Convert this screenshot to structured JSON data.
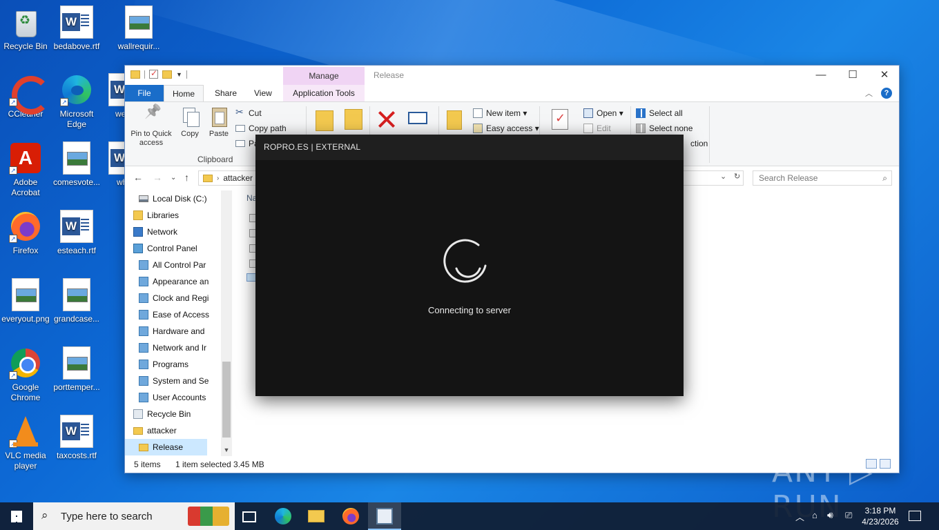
{
  "desktop": {
    "icons": [
      {
        "label": "Recycle Bin",
        "icon": "recycle-bin-icon"
      },
      {
        "label": "bedabove.rtf",
        "icon": "word-document-icon"
      },
      {
        "label": "wallrequir...",
        "icon": "image-file-icon"
      },
      {
        "label": "CCleaner",
        "icon": "ccleaner-icon"
      },
      {
        "label": "Microsoft Edge",
        "icon": "edge-icon"
      },
      {
        "label": "week",
        "icon": "word-document-icon"
      },
      {
        "label": "Adobe Acrobat",
        "icon": "acrobat-icon"
      },
      {
        "label": "comesvote...",
        "icon": "image-file-icon"
      },
      {
        "label": "whyi",
        "icon": "word-document-icon"
      },
      {
        "label": "Firefox",
        "icon": "firefox-icon"
      },
      {
        "label": "esteach.rtf",
        "icon": "word-document-icon"
      },
      {
        "label": "everyout.png",
        "icon": "image-file-icon"
      },
      {
        "label": "grandcase...",
        "icon": "image-file-icon"
      },
      {
        "label": "Google Chrome",
        "icon": "chrome-icon"
      },
      {
        "label": "porttemper...",
        "icon": "image-file-icon"
      },
      {
        "label": "VLC media player",
        "icon": "vlc-icon"
      },
      {
        "label": "taxcosts.rtf",
        "icon": "word-document-icon"
      }
    ]
  },
  "explorer": {
    "title": "Release",
    "contextual_tab": "Manage",
    "tabs": {
      "file": "File",
      "home": "Home",
      "share": "Share",
      "view": "View",
      "app_tools": "Application Tools"
    },
    "clipboard": {
      "pin": "Pin to Quick access",
      "copy": "Copy",
      "paste": "Paste",
      "cut": "Cut",
      "copy_path": "Copy path",
      "paste_shortcut": "Pa",
      "group_label": "Clipboard"
    },
    "new_group": {
      "new_item": "New item ▾",
      "easy_access": "Easy access ▾"
    },
    "open_group": {
      "open": "Open ▾",
      "edit": "Edit"
    },
    "select_group": {
      "select_all": "Select all",
      "select_none": "Select none",
      "invert": "ction"
    },
    "address": {
      "crumb": "attacker",
      "search_placeholder": "Search Release"
    },
    "nav_items": [
      {
        "label": "Local Disk (C:)",
        "icon": "disk-icon",
        "indent": 2
      },
      {
        "label": "Libraries",
        "icon": "library-icon",
        "indent": 1
      },
      {
        "label": "Network",
        "icon": "network-icon",
        "indent": 1
      },
      {
        "label": "Control Panel",
        "icon": "control-panel-icon",
        "indent": 1
      },
      {
        "label": "All Control Par",
        "icon": "control-panel-item-icon",
        "indent": 2
      },
      {
        "label": "Appearance an",
        "icon": "control-panel-item-icon",
        "indent": 2
      },
      {
        "label": "Clock and Regi",
        "icon": "control-panel-item-icon",
        "indent": 2
      },
      {
        "label": "Ease of Access",
        "icon": "control-panel-item-icon",
        "indent": 2
      },
      {
        "label": "Hardware and",
        "icon": "control-panel-item-icon",
        "indent": 2
      },
      {
        "label": "Network and Ir",
        "icon": "control-panel-item-icon",
        "indent": 2
      },
      {
        "label": "Programs",
        "icon": "control-panel-item-icon",
        "indent": 2
      },
      {
        "label": "System and Se",
        "icon": "control-panel-item-icon",
        "indent": 2
      },
      {
        "label": "User Accounts",
        "icon": "control-panel-item-icon",
        "indent": 2
      },
      {
        "label": "Recycle Bin",
        "icon": "recycle-bin-icon",
        "indent": 1
      },
      {
        "label": "attacker",
        "icon": "folder-icon",
        "indent": 1
      },
      {
        "label": "Release",
        "icon": "folder-icon",
        "indent": 2,
        "selected": true
      }
    ],
    "column_header": "Na",
    "status": {
      "items": "5 items",
      "selection": "1 item selected  3.45 MB"
    }
  },
  "dialog": {
    "title": "ROPRO.ES | EXTERNAL",
    "message": "Connecting to server"
  },
  "watermark": "ANY ▷ RUN",
  "taskbar": {
    "search_placeholder": "Type here to search",
    "time": "3:18 PM",
    "date": "4/23/2026"
  }
}
